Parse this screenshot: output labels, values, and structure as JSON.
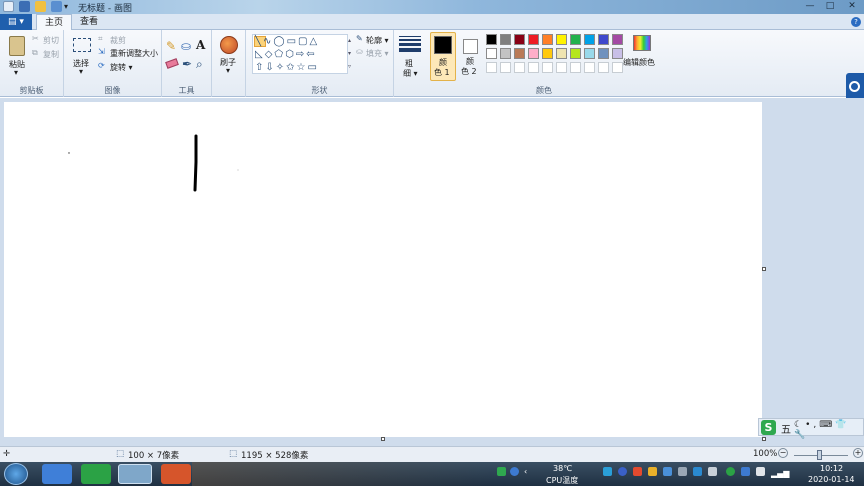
{
  "window": {
    "title": "无标题 - 画图",
    "controls": {
      "minimize": "—",
      "maximize": "□",
      "close": "✕"
    }
  },
  "tabs": {
    "file": "▾",
    "home": "主页",
    "view": "查看"
  },
  "ribbon": {
    "clipboard": {
      "group_label": "剪贴板",
      "paste": "粘贴",
      "cut": "剪切",
      "copy": "复制"
    },
    "image": {
      "group_label": "图像",
      "select": "选择",
      "crop": "裁剪",
      "resize": "重新调整大小",
      "rotate": "旋转 ▾"
    },
    "tools": {
      "group_label": "工具"
    },
    "brushes": {
      "label": "刷子"
    },
    "shapes": {
      "group_label": "形状",
      "outline": "轮廓 ▾",
      "fill": "填充 ▾"
    },
    "size": {
      "label1": "粗",
      "label2": "细 ▾"
    },
    "colors": {
      "group_label": "颜色",
      "color1_a": "颜",
      "color1_b": "色 1",
      "color2_a": "颜",
      "color2_b": "色 2",
      "color1_value": "#000000",
      "color2_value": "#ffffff",
      "edit": "编辑颜色",
      "palette_row1": [
        "#000000",
        "#7f7f7f",
        "#880015",
        "#ed1c24",
        "#ff7f27",
        "#fff200",
        "#22b14c",
        "#00a2e8",
        "#3f48cc",
        "#a349a4"
      ],
      "palette_row2": [
        "#ffffff",
        "#c3c3c3",
        "#b97a57",
        "#ffaec9",
        "#ffc90e",
        "#efe4b0",
        "#b5e61d",
        "#99d9ea",
        "#7092be",
        "#c8bfe7"
      ]
    }
  },
  "statusbar": {
    "selection_size": "100 × 7像素",
    "canvas_size": "1195 × 528像素",
    "zoom": "100%"
  },
  "ime": {
    "mode": "五"
  },
  "taskbar": {
    "temperature": "38℃",
    "cpu_label": "CPU温度",
    "time": "10:12",
    "date": "2020-01-14"
  }
}
